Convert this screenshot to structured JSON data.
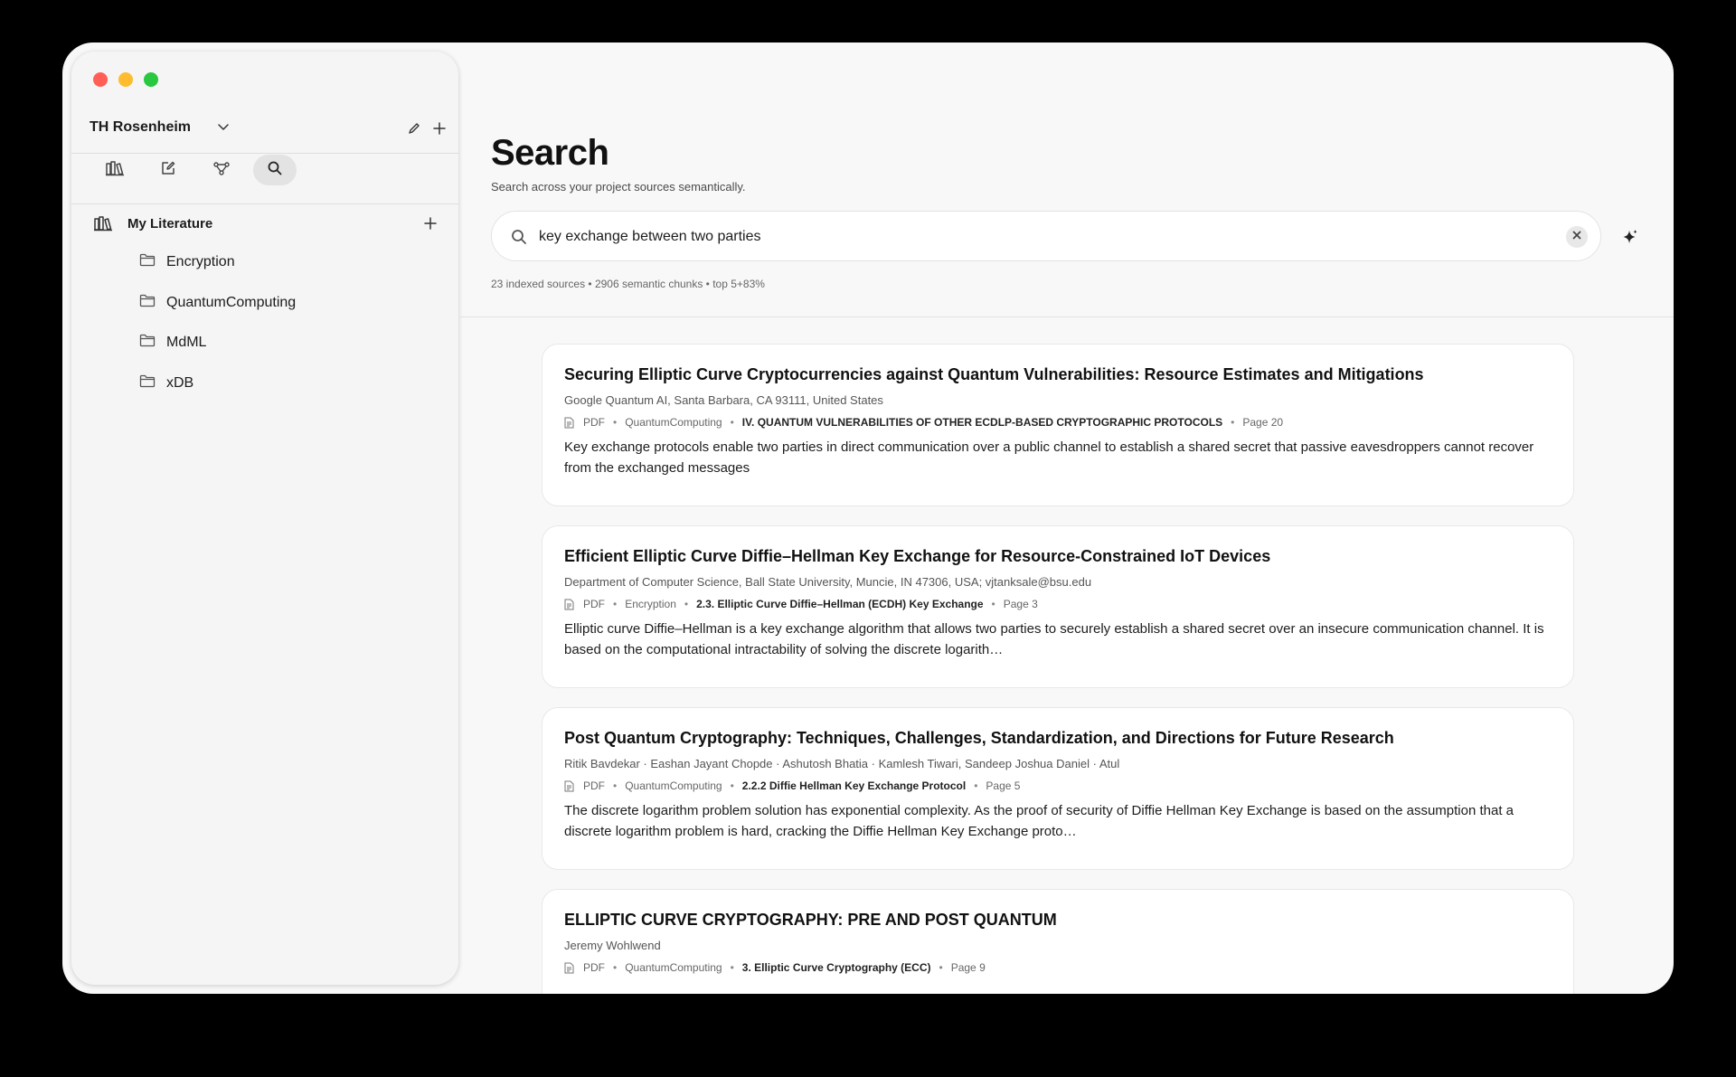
{
  "sidebar": {
    "workspace_name": "TH Rosenheim",
    "library": {
      "title": "My Literature",
      "folders": [
        {
          "name": "Encryption"
        },
        {
          "name": "QuantumComputing"
        },
        {
          "name": "MdML"
        },
        {
          "name": "xDB"
        }
      ]
    }
  },
  "main": {
    "title": "Search",
    "subtitle": "Search across your project sources semantically.",
    "query": "key exchange between two parties",
    "stats": "23 indexed sources • 2906 semantic chunks • top 5+83%"
  },
  "results": [
    {
      "title": "Securing Elliptic Curve Cryptocurrencies against Quantum Vulnerabilities: Resource Estimates and Mitigations",
      "authors": "Google Quantum AI, Santa Barbara, CA 93111, United States",
      "type": "PDF",
      "folder": "QuantumComputing",
      "section": "IV. QUANTUM VULNERABILITIES OF OTHER ECDLP-BASED CRYPTOGRAPHIC PROTOCOLS",
      "page": "Page 20",
      "snippet": "Key exchange protocols enable two parties in direct communication over a public channel to establish a shared secret that passive eavesdroppers cannot recover from the exchanged messages"
    },
    {
      "title": "Efficient Elliptic Curve Diffie–Hellman Key Exchange for Resource-Constrained IoT Devices",
      "authors": "Department of Computer Science, Ball State University, Muncie, IN 47306, USA; vjtanksale@bsu.edu",
      "type": "PDF",
      "folder": "Encryption",
      "section": "2.3. Elliptic Curve Diffie–Hellman (ECDH) Key Exchange",
      "page": "Page 3",
      "snippet": "Elliptic curve Diffie–Hellman is a key exchange algorithm that allows two parties to securely establish a shared secret over an insecure communication channel. It is based on the computational intractability of solving the discrete logarith…"
    },
    {
      "title": "Post Quantum Cryptography: Techniques, Challenges, Standardization, and Directions for Future Research",
      "authors": "Ritik Bavdekar · Eashan Jayant Chopde · Ashutosh Bhatia · Kamlesh Tiwari, Sandeep Joshua Daniel · Atul",
      "type": "PDF",
      "folder": "QuantumComputing",
      "section": "2.2.2 Diffie Hellman Key Exchange Protocol",
      "page": "Page 5",
      "snippet": "The discrete logarithm problem solution has exponential complexity. As the proof of security of Diffie Hellman Key Exchange is based on the assumption that a discrete logarithm problem is hard, cracking the Diffie Hellman Key Exchange proto…"
    },
    {
      "title": "ELLIPTIC CURVE CRYPTOGRAPHY: PRE AND POST QUANTUM",
      "authors": "Jeremy Wohlwend",
      "type": "PDF",
      "folder": "QuantumComputing",
      "section": "3. Elliptic Curve Cryptography (ECC)",
      "page": "Page 9",
      "snippet": ""
    }
  ]
}
